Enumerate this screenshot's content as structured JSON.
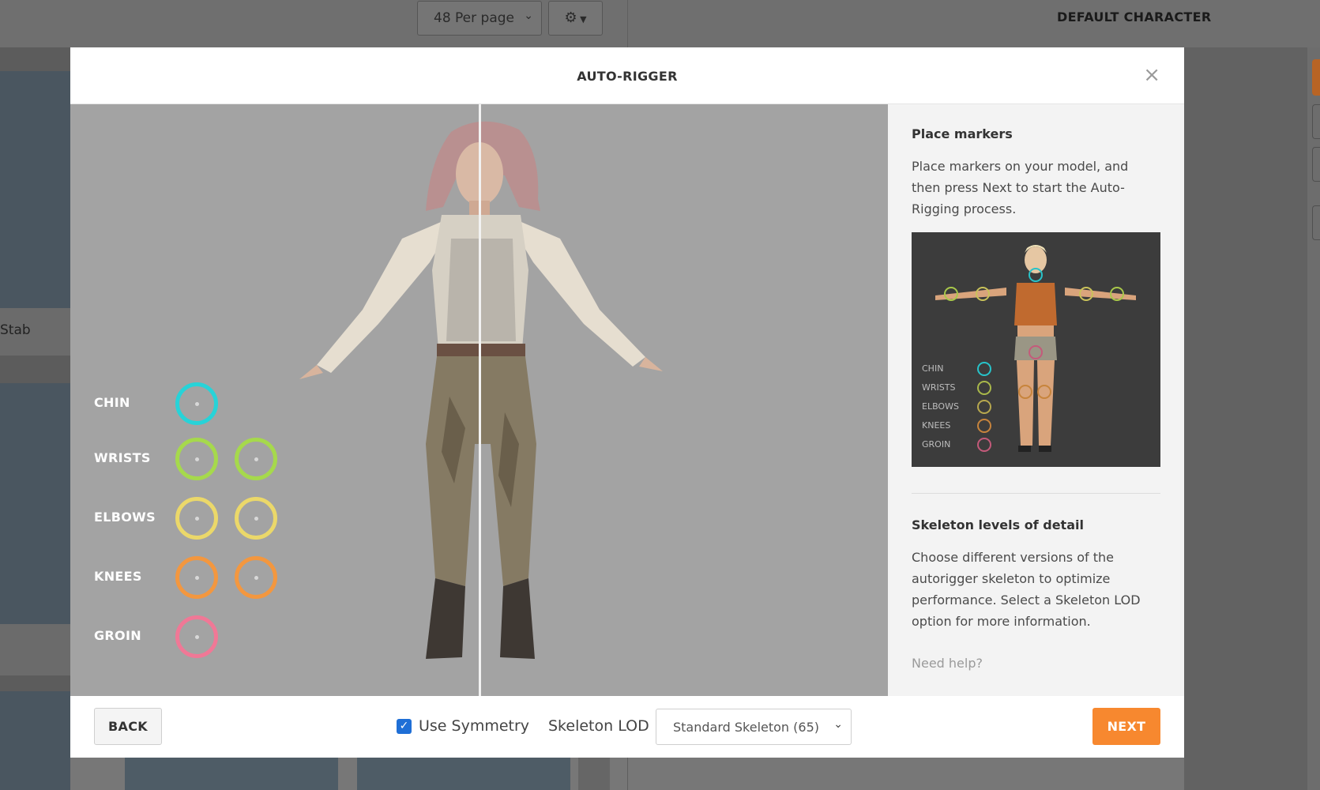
{
  "background": {
    "per_page": "48 Per page",
    "gear_icon": "gear-icon",
    "default_character": "DEFAULT CHARACTER",
    "card_caption": "Stab"
  },
  "modal": {
    "title": "AUTO-RIGGER",
    "close": "×",
    "markers": [
      {
        "label": "CHIN",
        "color": "#27d3d8",
        "count": 1
      },
      {
        "label": "WRISTS",
        "color": "#a6d94c",
        "count": 2
      },
      {
        "label": "ELBOWS",
        "color": "#ebd86a",
        "count": 2
      },
      {
        "label": "KNEES",
        "color": "#f3973f",
        "count": 2
      },
      {
        "label": "GROIN",
        "color": "#f07896",
        "count": 1
      }
    ],
    "side": {
      "place_title": "Place markers",
      "place_text": "Place markers on your model, and then press Next to start the Auto-Rigging process.",
      "reference_legend": [
        {
          "label": "CHIN",
          "color": "#27c3c9"
        },
        {
          "label": "WRISTS",
          "color": "#a9b84a"
        },
        {
          "label": "ELBOWS",
          "color": "#b7a84e"
        },
        {
          "label": "KNEES",
          "color": "#c7843c"
        },
        {
          "label": "GROIN",
          "color": "#c45a7a"
        }
      ],
      "lod_title": "Skeleton levels of detail",
      "lod_text": "Choose different versions of the autorigger skeleton to optimize performance. Select a Skeleton LOD option for more information.",
      "help": "Need help?"
    },
    "footer": {
      "back": "BACK",
      "use_symmetry": "Use Symmetry",
      "use_symmetry_checked": true,
      "lod_label": "Skeleton LOD",
      "lod_value": "Standard Skeleton (65)",
      "next": "NEXT"
    }
  },
  "colors": {
    "accent": "#f7882f",
    "checkbox": "#1f6fd6"
  }
}
